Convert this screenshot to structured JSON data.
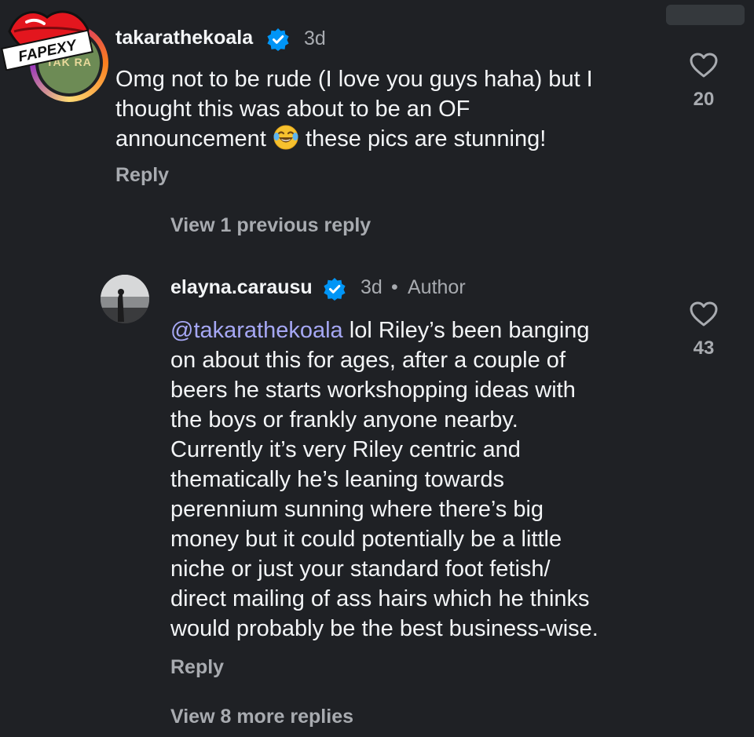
{
  "comments": [
    {
      "username": "takarathekoala",
      "verified": true,
      "time": "3d",
      "text_before_emoji": "Omg not to be rude (I love you guys haha) but I\nthought this was about to be an OF\nannouncement ",
      "emoji": "face-with-tears-of-joy",
      "text_after_emoji": " these pics are stunning!",
      "reply_label": "Reply",
      "likes": "20",
      "avatar_text": "TAK  RA"
    },
    {
      "username": "elayna.carausu",
      "verified": true,
      "time": "3d",
      "separator": "•",
      "author_label": "Author",
      "mention": "@takarathekoala",
      "text": " lol Riley’s been banging\non about this for ages, after a couple of\nbeers he starts workshopping ideas with\nthe boys or frankly anyone nearby.\nCurrently it’s very Riley centric and\nthematically he’s leaning towards\nperennium sunning where there’s big\nmoney but it could potentially be a little\nniche or just your standard foot fetish/\ndirect mailing of ass hairs which he thinks\nwould probably be the best business-wise.",
      "reply_label": "Reply",
      "likes": "43"
    }
  ],
  "view_previous": "View 1 previous reply",
  "view_more": "View 8 more replies",
  "watermark": "FAPEXY",
  "colors": {
    "background": "#1f2125",
    "text": "#f3f5f7",
    "secondary": "#a8abb0",
    "mention": "#a6a8f5",
    "verified": "#0095f6"
  }
}
